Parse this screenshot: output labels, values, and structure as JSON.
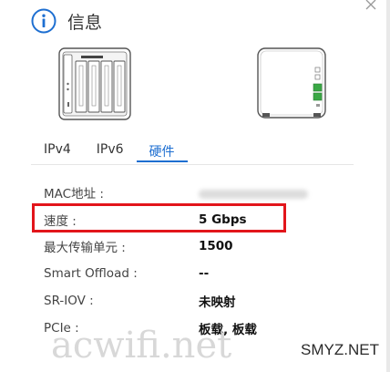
{
  "header": {
    "title": "信息",
    "icon": "info-icon",
    "accent_color": "#1e6fd1"
  },
  "tabs": [
    {
      "label": "IPv4",
      "active": false
    },
    {
      "label": "IPv6",
      "active": false
    },
    {
      "label": "硬件",
      "active": true
    }
  ],
  "rows": [
    {
      "label": "MAC地址 :",
      "value": ""
    },
    {
      "label": "速度 :",
      "value": "5 Gbps"
    },
    {
      "label": "最大传输单元 :",
      "value": "1500"
    },
    {
      "label": "Smart Offload :",
      "value": "--"
    },
    {
      "label": "SR-IOV :",
      "value": "未映射"
    },
    {
      "label": "PCIe :",
      "value": "板载, 板载"
    }
  ],
  "highlight_color": "#e2151b",
  "watermark": {
    "text": "acwifi.net",
    "corner_text": "SMYZ.NET"
  }
}
